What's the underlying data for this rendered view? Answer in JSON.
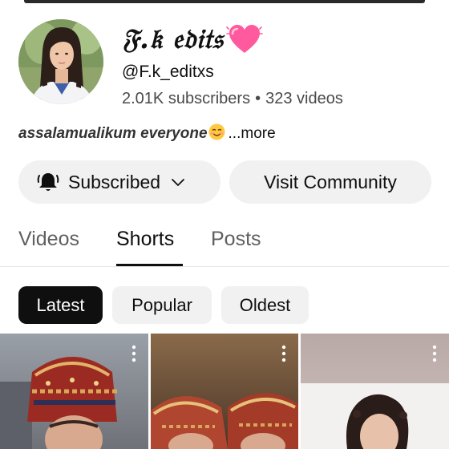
{
  "channel": {
    "name": "𝔉.𝔨 𝔢𝔡𝔦𝔱𝔰",
    "name_emoji": "sparkling-heart-icon",
    "handle": "@F.k_editxs",
    "subscribers": "2.01K subscribers",
    "stats_separator": "•",
    "videos": "323 videos",
    "description": "assalamualikum everyone",
    "description_emoji": "smiling-face-icon",
    "more_label": "...more"
  },
  "actions": {
    "subscribed_label": "Subscribed",
    "community_label": "Visit Community"
  },
  "tabs": [
    {
      "label": "Videos",
      "active": false
    },
    {
      "label": "Shorts",
      "active": true
    },
    {
      "label": "Posts",
      "active": false
    }
  ],
  "chips": [
    {
      "label": "Latest",
      "active": true
    },
    {
      "label": "Popular",
      "active": false
    },
    {
      "label": "Oldest",
      "active": false
    }
  ],
  "shorts": [
    {
      "thumbnail": "woman-in-embroidered-headdress",
      "menu_icon": "kebab-menu-icon"
    },
    {
      "thumbnail": "two-women-in-embroidered-headdresses",
      "menu_icon": "kebab-menu-icon"
    },
    {
      "thumbnail": "woman-with-braided-updo",
      "menu_icon": "kebab-menu-icon"
    }
  ],
  "colors": {
    "text_primary": "#0f0f0f",
    "text_secondary": "#606060",
    "chip_bg": "#f1f1f1",
    "chip_active_bg": "#0f0f0f",
    "heart_pink": "#ff4f9a"
  }
}
